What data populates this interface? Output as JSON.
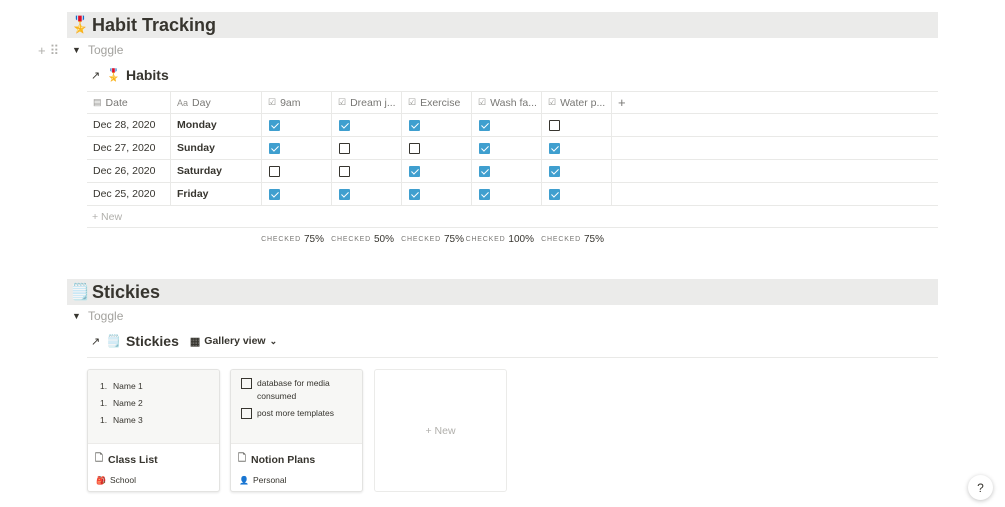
{
  "habit_section": {
    "emoji": "🎖️",
    "title": "Habit Tracking",
    "toggle_label": "Toggle",
    "database": {
      "arrow": "↗",
      "emoji": "🎖️",
      "title": "Habits",
      "columns": [
        {
          "icon": "calendar-icon",
          "glyph": "▤",
          "label": "Date"
        },
        {
          "icon": "text-property-icon",
          "glyph": "Aa",
          "label": "Day"
        },
        {
          "icon": "checkbox-property-icon",
          "glyph": "☑",
          "label": "9am"
        },
        {
          "icon": "checkbox-property-icon",
          "glyph": "☑",
          "label": "Dream j..."
        },
        {
          "icon": "checkbox-property-icon",
          "glyph": "☑",
          "label": "Exercise"
        },
        {
          "icon": "checkbox-property-icon",
          "glyph": "☑",
          "label": "Wash fa..."
        },
        {
          "icon": "checkbox-property-icon",
          "glyph": "☑",
          "label": "Water p..."
        }
      ],
      "add_column": "+",
      "rows": [
        {
          "date": "Dec 28, 2020",
          "day": "Monday",
          "checks": [
            true,
            true,
            true,
            true,
            false
          ]
        },
        {
          "date": "Dec 27, 2020",
          "day": "Sunday",
          "checks": [
            true,
            false,
            false,
            true,
            true
          ]
        },
        {
          "date": "Dec 26, 2020",
          "day": "Saturday",
          "checks": [
            false,
            false,
            true,
            true,
            true
          ]
        },
        {
          "date": "Dec 25, 2020",
          "day": "Friday",
          "checks": [
            true,
            true,
            true,
            true,
            true
          ]
        }
      ],
      "new_label": "+ New",
      "calculations": [
        {
          "label": "CHECKED",
          "value": "75%"
        },
        {
          "label": "CHECKED",
          "value": "50%"
        },
        {
          "label": "CHECKED",
          "value": "75%"
        },
        {
          "label": "CHECKED",
          "value": "100%"
        },
        {
          "label": "CHECKED",
          "value": "75%"
        }
      ]
    }
  },
  "stickies_section": {
    "emoji": "🗒️",
    "title": "Stickies",
    "toggle_label": "Toggle",
    "database": {
      "arrow": "↗",
      "emoji": "🗒️",
      "title": "Stickies",
      "view_label": "Gallery view",
      "view_icon": "▦",
      "cards": [
        {
          "title": "Class List",
          "tag_icon": "🎒",
          "tag": "School",
          "list": [
            "Name 1",
            "Name 2",
            "Name 3"
          ],
          "list_num": "1."
        },
        {
          "title": "Notion Plans",
          "tag_icon": "👤",
          "tag": "Personal",
          "todos": [
            "database for media consumed",
            "post more templates"
          ]
        }
      ],
      "new_label": "+ New"
    }
  },
  "help_label": "?",
  "colors": {
    "checked": "#3f9fcf",
    "heading_bg": "#ebebea",
    "text": "#37352f"
  }
}
